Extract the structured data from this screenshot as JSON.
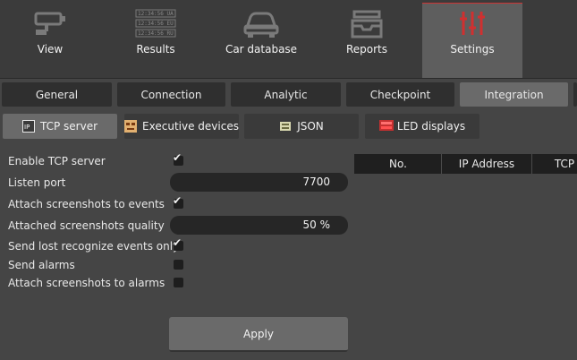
{
  "topnav": {
    "items": [
      {
        "label": "View",
        "icon": "camera-icon"
      },
      {
        "label": "Results",
        "icon": "results-list-icon",
        "icon_lines": [
          "12:34:56 UA",
          "12:34:56 EU",
          "12:34:56 RU"
        ]
      },
      {
        "label": "Car database",
        "icon": "car-icon"
      },
      {
        "label": "Reports",
        "icon": "inbox-tray-icon"
      },
      {
        "label": "Settings",
        "icon": "sliders-icon"
      }
    ],
    "active": "Settings",
    "accent": "#cc3333"
  },
  "tabs": {
    "items": [
      "General",
      "Connection",
      "Analytic",
      "Checkpoint",
      "Integration"
    ],
    "active": "Integration"
  },
  "subtabs": {
    "items": [
      {
        "label": "TCP server",
        "icon": "ip-icon"
      },
      {
        "label": "Executive devices",
        "icon": "device-icon"
      },
      {
        "label": "JSON",
        "icon": "json-icon"
      },
      {
        "label": "LED displays",
        "icon": "led-display-icon"
      }
    ],
    "active": "TCP server"
  },
  "form": {
    "enable_tcp": {
      "label": "Enable TCP server",
      "checked": true
    },
    "listen_port": {
      "label": "Listen port",
      "value": "7700"
    },
    "attach_screens_events": {
      "label": "Attach screenshots to events",
      "checked": true
    },
    "screens_quality": {
      "label": "Attached screenshots quality",
      "value": "50 %"
    },
    "send_lost": {
      "label": "Send lost recognize events only",
      "checked": true
    },
    "send_alarms": {
      "label": "Send alarms",
      "checked": false
    },
    "attach_screens_alarms": {
      "label": "Attach screenshots to alarms",
      "checked": false
    },
    "apply_label": "Apply"
  },
  "table": {
    "columns": [
      "No.",
      "IP Address",
      "TCP"
    ]
  }
}
